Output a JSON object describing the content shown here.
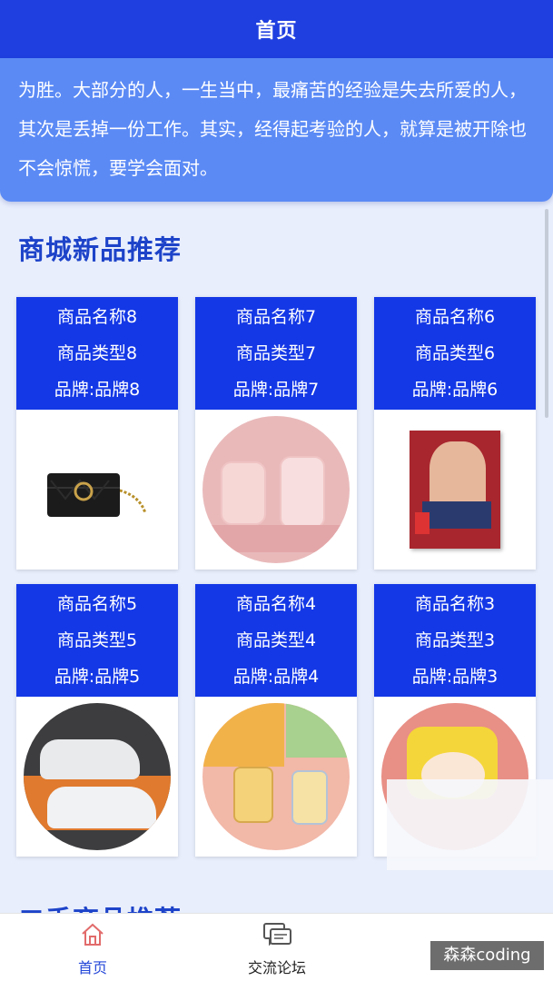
{
  "nav": {
    "title": "首页"
  },
  "notice": {
    "text": "为胜。大部分的人，一生当中，最痛苦的经验是失去所爱的人，其次是丢掉一份工作。其实，经得起考验的人，就算是被开除也不会惊慌，要学会面对。"
  },
  "sections": {
    "new_title": "商城新品推荐",
    "used_title": "二手商品推荐"
  },
  "products": [
    {
      "name": "商品名称8",
      "type": "商品类型8",
      "brand": "品牌:品牌8",
      "image": "black-handbag"
    },
    {
      "name": "商品名称7",
      "type": "商品类型7",
      "brand": "品牌:品牌7",
      "image": "pink-baby-bottles"
    },
    {
      "name": "商品名称6",
      "type": "商品类型6",
      "brand": "品牌:品牌6",
      "image": "red-book-cover"
    },
    {
      "name": "商品名称5",
      "type": "商品类型5",
      "brand": "品牌:品牌5",
      "image": "white-sneakers"
    },
    {
      "name": "商品名称4",
      "type": "商品类型4",
      "brand": "品牌:品牌4",
      "image": "baby-sippy-cups"
    },
    {
      "name": "商品名称3",
      "type": "商品类型3",
      "brand": "品牌:品牌3",
      "image": "yellow-tiger-toy"
    }
  ],
  "tabbar": {
    "home_label": "首页",
    "forum_label": "交流论坛"
  },
  "watermark": "森森coding",
  "colors": {
    "primary": "#1438e6",
    "notice": "#5b8af5",
    "section_title": "#1d43c9",
    "background": "#e8eefc"
  }
}
